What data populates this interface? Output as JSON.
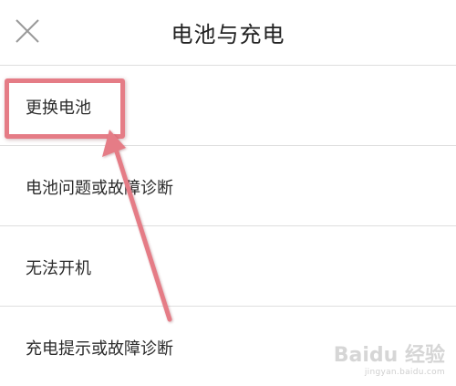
{
  "header": {
    "title": "电池与充电",
    "close_icon": "close-icon"
  },
  "menu": {
    "items": [
      {
        "label": "更换电池"
      },
      {
        "label": "电池问题或故障诊断"
      },
      {
        "label": "无法开机"
      },
      {
        "label": "充电提示或故障诊断"
      }
    ]
  },
  "annotation": {
    "color": "#e57c86",
    "highlighted_item": "更换电池"
  },
  "watermark": {
    "brand": "Baidu 经验",
    "url": "jingyan.baidu.com"
  }
}
